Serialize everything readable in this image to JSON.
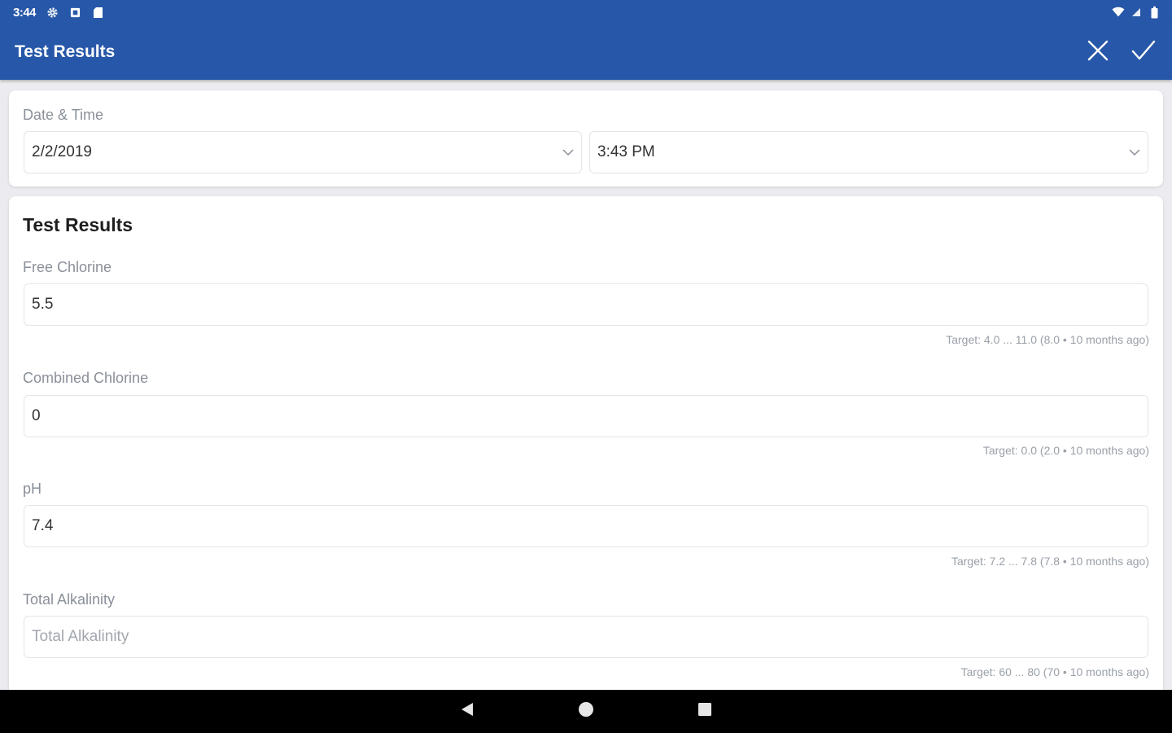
{
  "status_bar": {
    "time": "3:44",
    "left_icons": [
      "gear-icon",
      "square-icon",
      "sd-card-icon"
    ],
    "right_icons": [
      "wifi-icon",
      "cell-signal-icon",
      "battery-icon"
    ]
  },
  "app_bar": {
    "title": "Test Results",
    "cancel_icon": "close-icon",
    "confirm_icon": "check-icon"
  },
  "datetime": {
    "label": "Date & Time",
    "date_value": "2/2/2019",
    "time_value": "3:43 PM"
  },
  "results": {
    "title": "Test Results",
    "fields": [
      {
        "label": "Free Chlorine",
        "value": "5.5",
        "placeholder": "Free Chlorine",
        "hint": "Target: 4.0 ... 11.0   (8.0 • 10 months ago)"
      },
      {
        "label": "Combined Chlorine",
        "value": "0",
        "placeholder": "Combined Chlorine",
        "hint": "Target: 0.0   (2.0 • 10 months ago)"
      },
      {
        "label": "pH",
        "value": "7.4",
        "placeholder": "pH",
        "hint": "Target: 7.2 ... 7.8   (7.8 • 10 months ago)"
      },
      {
        "label": "Total Alkalinity",
        "value": "",
        "placeholder": "Total Alkalinity",
        "hint": "Target: 60 ... 80   (70 • 10 months ago)"
      }
    ]
  },
  "nav_bar": {
    "icons": [
      "back-icon",
      "home-icon",
      "recents-icon"
    ]
  },
  "colors": {
    "primary": "#2757a8",
    "background": "#ececf0"
  }
}
